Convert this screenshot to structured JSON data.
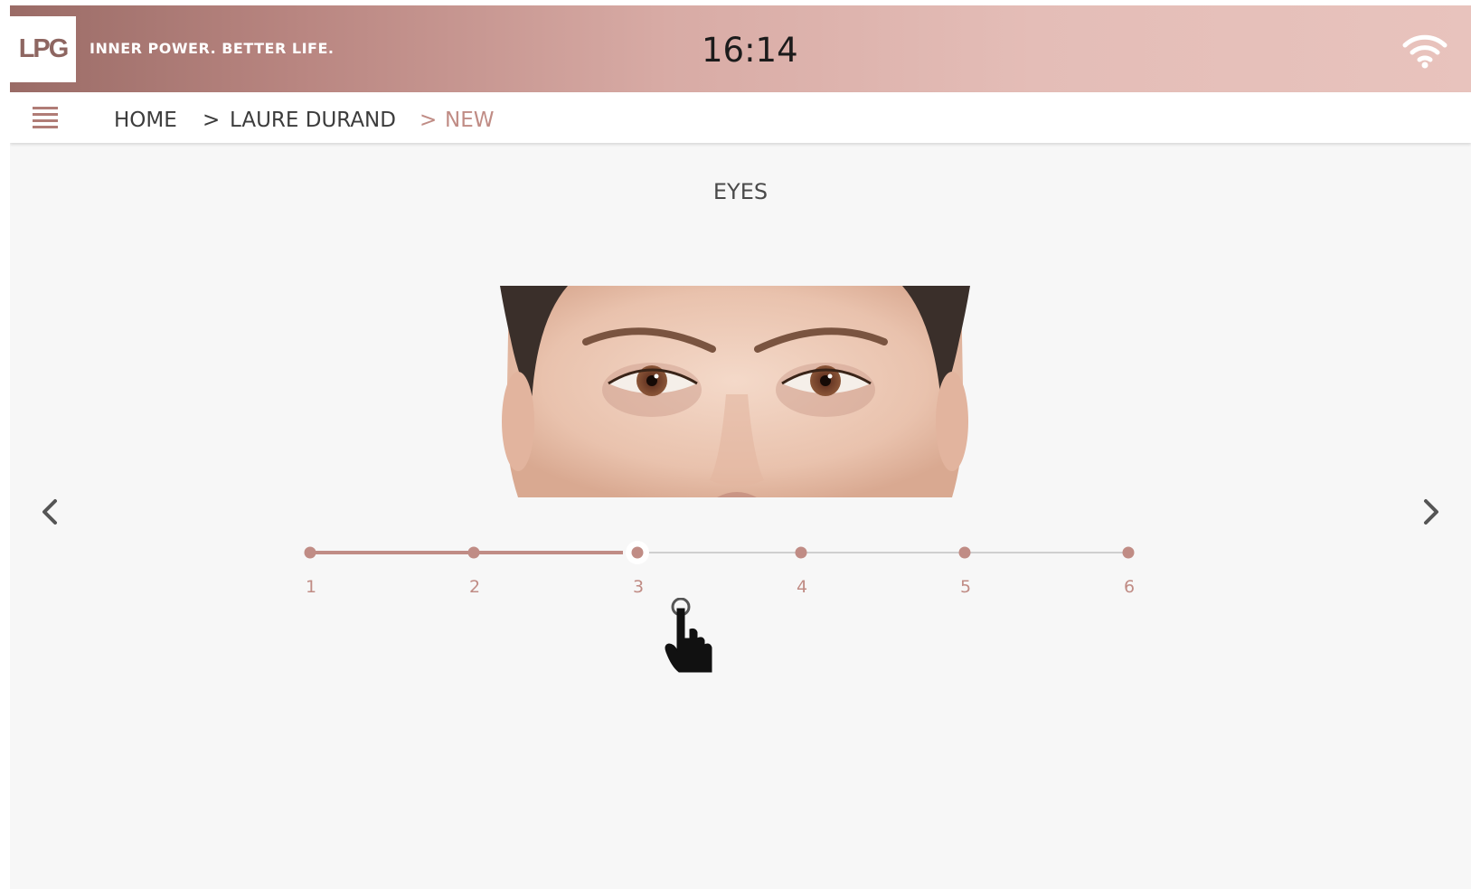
{
  "header": {
    "logo_text": "LPG",
    "tagline": "INNER POWER. BETTER LIFE.",
    "clock": "16:14",
    "status_icon": "wifi-icon"
  },
  "breadcrumb": {
    "menu_icon": "hamburger-menu-icon",
    "items": [
      "HOME",
      "LAURE DURAND",
      "NEW"
    ],
    "separator": ">"
  },
  "section": {
    "title": "EYES"
  },
  "navigation": {
    "prev_icon": "chevron-left-icon",
    "next_icon": "chevron-right-icon"
  },
  "slider": {
    "ticks": [
      "1",
      "2",
      "3",
      "4",
      "5",
      "6"
    ],
    "selected_index": 2
  },
  "colors": {
    "accent": "#c08c85",
    "header_dark": "#9a6b66",
    "header_light": "#e8c3bd",
    "track_inactive": "#cfcfcf"
  }
}
